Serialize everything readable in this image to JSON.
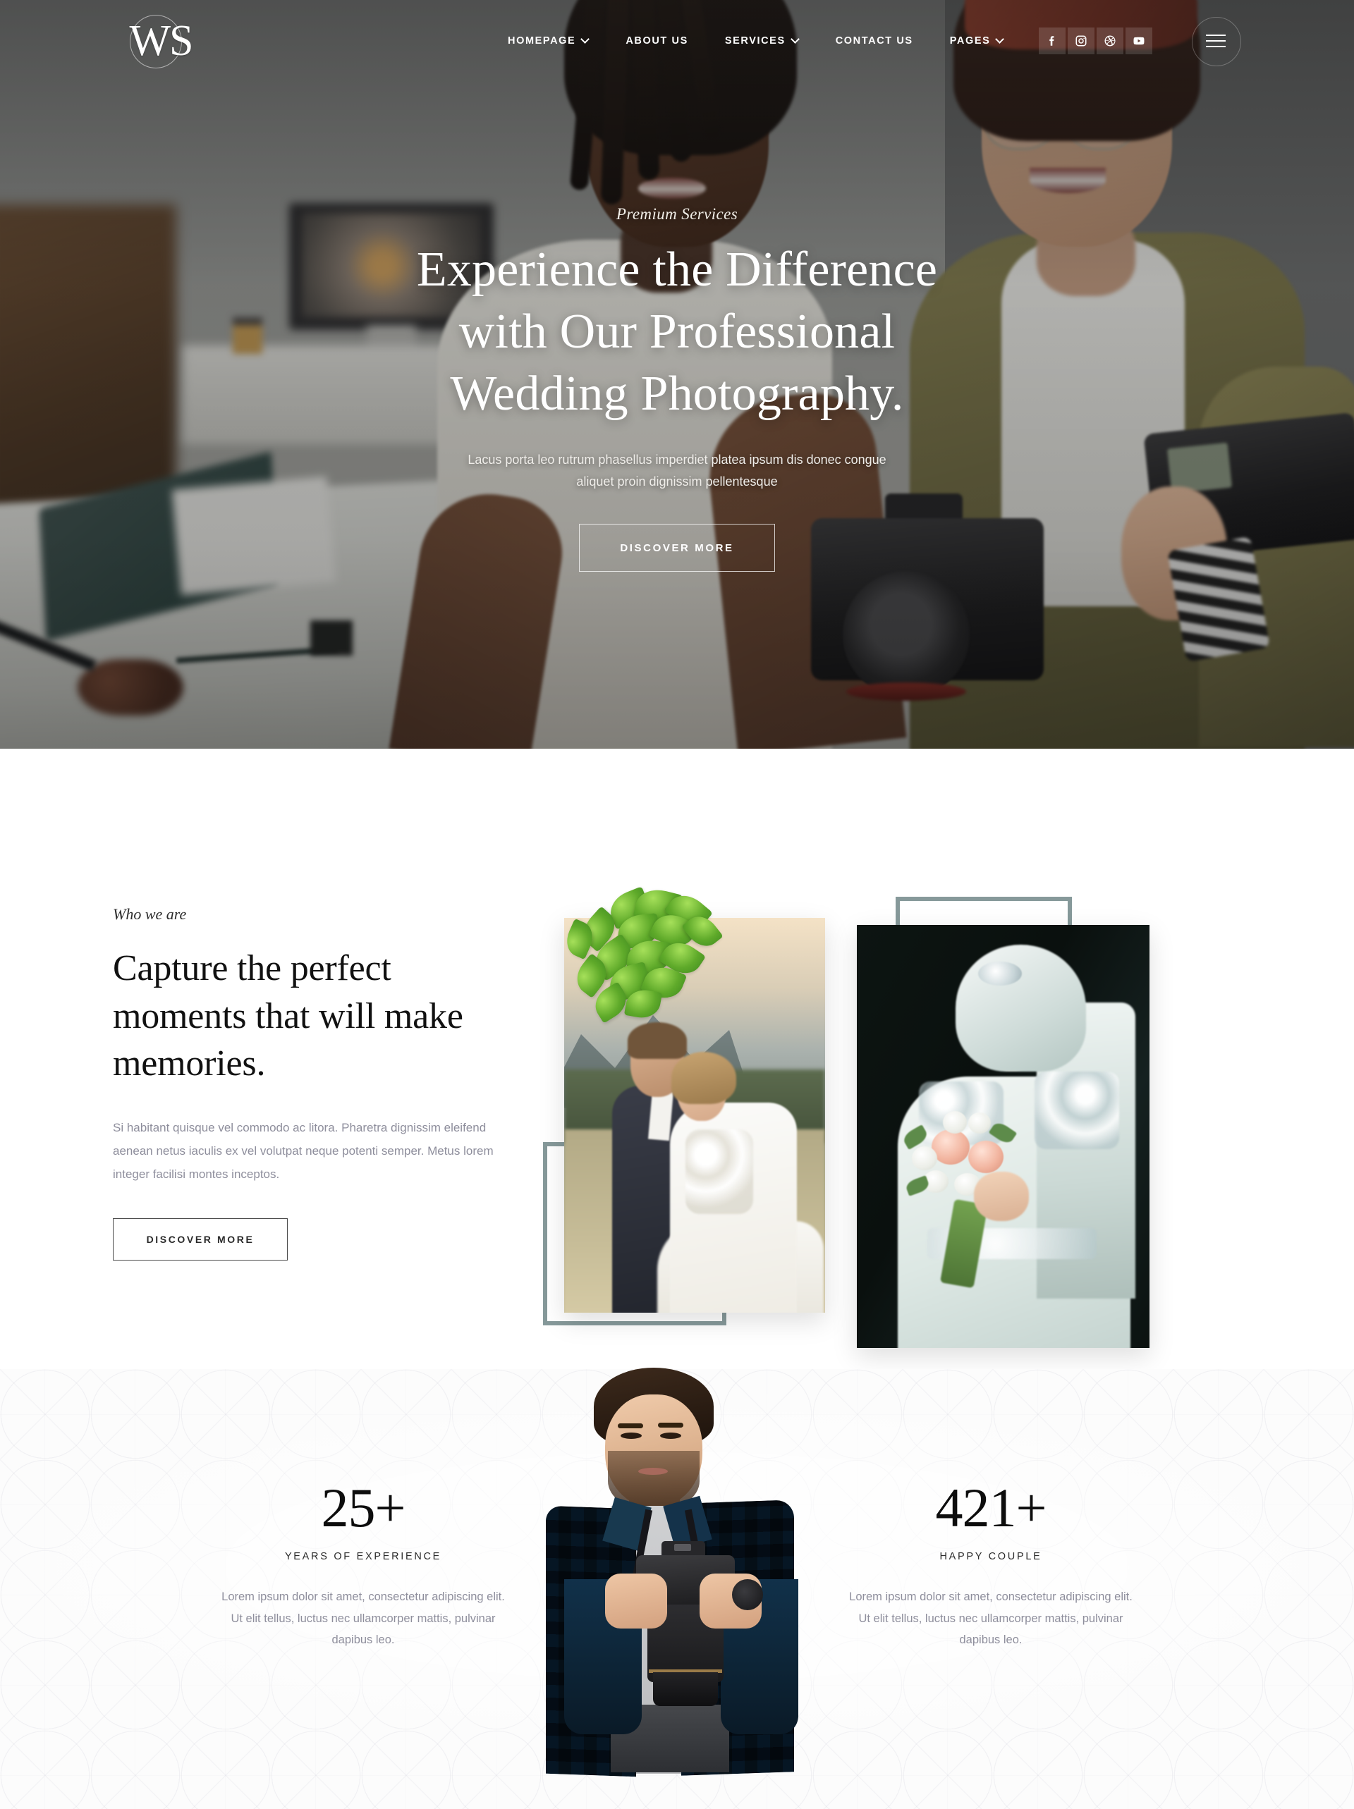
{
  "brand": {
    "logo_text": "WS",
    "logo_icon": "circle-monogram"
  },
  "nav": {
    "items": [
      {
        "label": "HOMEPAGE",
        "has_dropdown": true
      },
      {
        "label": "ABOUT US",
        "has_dropdown": false
      },
      {
        "label": "SERVICES",
        "has_dropdown": true
      },
      {
        "label": "CONTACT US",
        "has_dropdown": false
      },
      {
        "label": "PAGES",
        "has_dropdown": true
      }
    ],
    "social": [
      {
        "name": "facebook-icon"
      },
      {
        "name": "instagram-icon"
      },
      {
        "name": "dribbble-icon"
      },
      {
        "name": "youtube-icon"
      }
    ],
    "menu_toggle": "hamburger-menu-icon"
  },
  "hero": {
    "eyebrow": "Premium Services",
    "title_line1": "Experience the Difference",
    "title_line2": "with Our Professional",
    "title_line3": "Wedding Photography.",
    "subtitle_line1": "Lacus porta leo rutrum phasellus imperdiet platea ipsum dis donec congue",
    "subtitle_line2": "aliquet proin dignissim pellentesque",
    "cta_label": "DISCOVER MORE"
  },
  "about": {
    "kicker": "Who we are",
    "title_line1": "Capture the perfect",
    "title_line2": "moments that will make",
    "title_line3": "memories.",
    "body": "Si habitant quisque vel commodo ac litora. Pharetra dignissim eleifend aenean netus iaculis ex vel volutpat neque potenti semper. Metus lorem integer facilisi montes inceptos.",
    "cta_label": "DISCOVER MORE",
    "images": [
      {
        "name": "couple-outdoor-photo",
        "alt": "Groom and bride embracing in a mountain field at sunset"
      },
      {
        "name": "bride-portrait-photo",
        "alt": "Bride in white beaded gown and turban holding a bouquet"
      }
    ],
    "decor": {
      "frame_color": "#86999a",
      "plant": "pothos-leaves-decoration"
    }
  },
  "stats": {
    "items": [
      {
        "value": "25+",
        "label": "YEARS OF EXPERIENCE",
        "description": "Lorem ipsum dolor sit amet, consectetur adipiscing elit. Ut elit tellus, luctus nec ullamcorper mattis, pulvinar dapibus leo."
      },
      {
        "value": "421+",
        "label": "HAPPY COUPLE",
        "description": "Lorem ipsum dolor sit amet, consectetur adipiscing elit. Ut elit tellus, luctus nec ullamcorper mattis, pulvinar dapibus leo."
      }
    ],
    "center_image": {
      "name": "photographer-portrait",
      "alt": "Male photographer in blue plaid shirt holding a DSLR camera"
    },
    "background_pattern": "geometric-lattice"
  },
  "colors": {
    "accent_sage": "#86999a",
    "text_dark": "#111111",
    "text_muted": "#8e8e9c",
    "hero_overlay": "rgba(22,22,22,0.4)",
    "page_bg": "#ffffff"
  }
}
